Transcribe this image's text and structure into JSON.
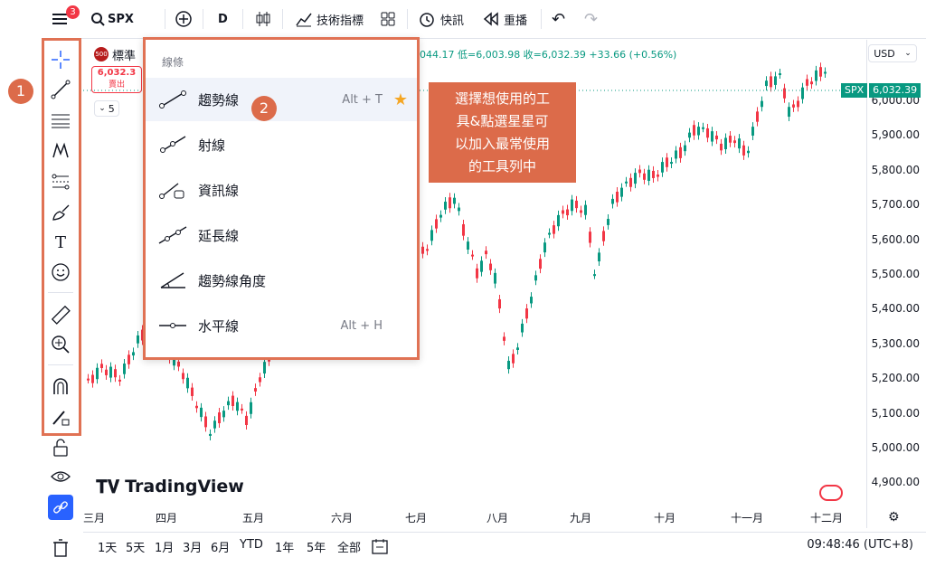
{
  "topbar": {
    "menu_badge": "3",
    "symbol": "SPX",
    "interval": "D",
    "indicators_label": "技術指標",
    "alert_label": "快訊",
    "replay_label": "重播"
  },
  "legend": {
    "badge": "500",
    "name": "標準",
    "sell_price": "6,032.3",
    "sell_label": "賣出",
    "collapse_count": "5",
    "ohlc_text": "044.17 低=6,003.98 收=6,032.39 +33.66 (+0.56%)"
  },
  "dropdown": {
    "header": "線條",
    "items": [
      {
        "label": "趨勢線",
        "shortcut": "Alt + T",
        "icon": "trend-line-icon"
      },
      {
        "label": "射線",
        "shortcut": "",
        "icon": "ray-icon"
      },
      {
        "label": "資訊線",
        "shortcut": "",
        "icon": "info-line-icon"
      },
      {
        "label": "延長線",
        "shortcut": "",
        "icon": "extended-line-icon"
      },
      {
        "label": "趨勢線角度",
        "shortcut": "",
        "icon": "trend-angle-icon"
      },
      {
        "label": "水平線",
        "shortcut": "Alt + H",
        "icon": "horizontal-line-icon"
      }
    ]
  },
  "callout": {
    "lines": [
      "選擇想使用的工",
      "具&點選星星可",
      "以加入最常使用",
      "的工具列中"
    ]
  },
  "markers": {
    "one": "1",
    "two": "2"
  },
  "price_axis": {
    "currency": "USD",
    "symbol_tag": "SPX",
    "last_price": "6,032.39",
    "ticks": [
      "6,000.00",
      "5,900.00",
      "5,800.00",
      "5,700.00",
      "5,600.00",
      "5,500.00",
      "5,400.00",
      "5,300.00",
      "5,200.00",
      "5,100.00",
      "5,000.00",
      "4,900.00"
    ]
  },
  "time_axis": {
    "labels": [
      "三月",
      "四月",
      "五月",
      "六月",
      "七月",
      "八月",
      "九月",
      "十月",
      "十一月",
      "十二月"
    ]
  },
  "bottombar": {
    "periods": [
      "1天",
      "5天",
      "1月",
      "3月",
      "6月",
      "YTD",
      "1年",
      "5年",
      "全部"
    ],
    "clock": "09:48:46 (UTC+8)"
  },
  "watermark": "TradingView",
  "colors": {
    "up": "#089981",
    "down": "#f23645",
    "accent": "#dc6b4a",
    "blue": "#2962ff"
  }
}
